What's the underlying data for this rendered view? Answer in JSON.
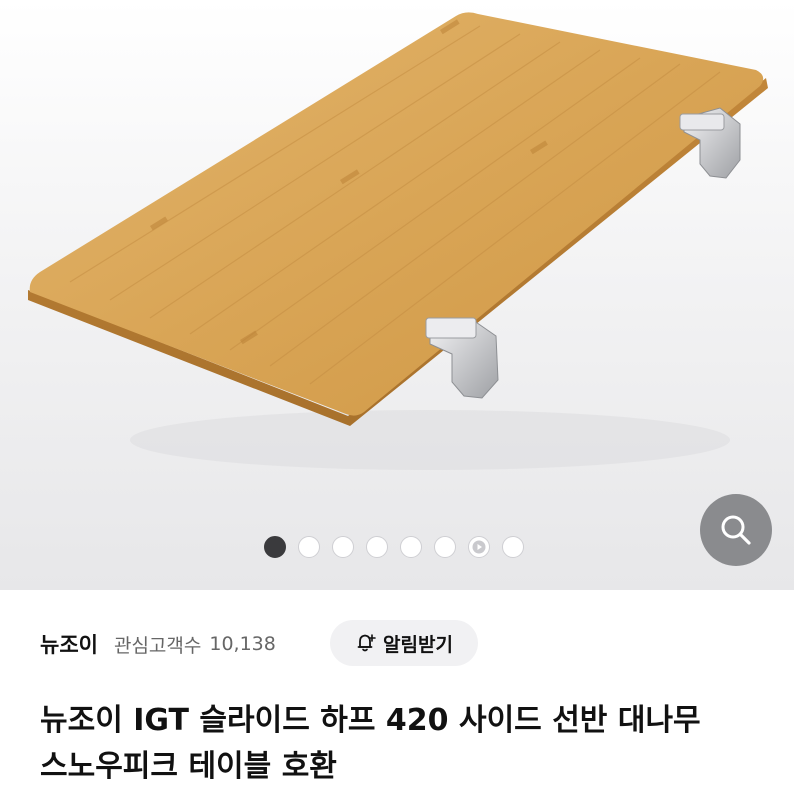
{
  "gallery": {
    "image_alt": "bamboo side shelf board with aluminum hooks",
    "dot_count": 8,
    "active_index": 0,
    "video_index": 6,
    "zoom_icon": "search-icon"
  },
  "seller": {
    "name": "뉴조이",
    "followers_label": "관심고객수",
    "followers_count": "10,138"
  },
  "alert_button": {
    "icon": "bell-plus-icon",
    "label": "알림받기"
  },
  "product": {
    "title": "뉴조이 IGT 슬라이드 하프 420 사이드 선반 대나무 스노우피크 테이블 호환"
  },
  "colors": {
    "dot_active": "#3a3a3d",
    "zoom_button": "#8a8b8e",
    "alert_button_bg": "#f1f1f3",
    "wood": "#d8a45a"
  }
}
